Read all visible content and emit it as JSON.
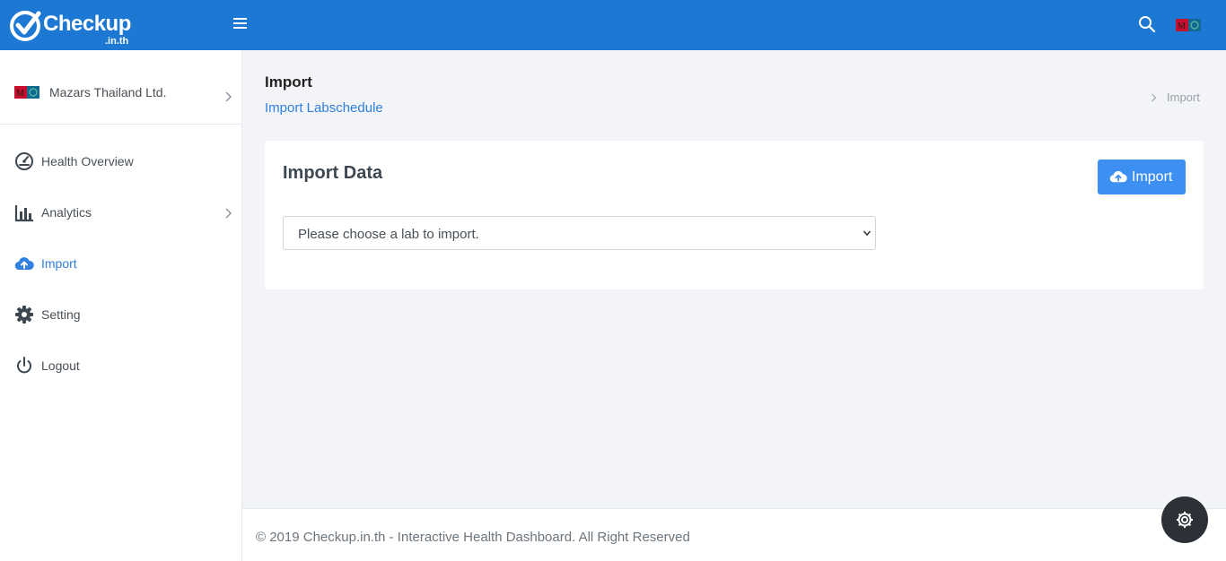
{
  "header": {
    "brand": "Checkup",
    "brand_sub": ".in.th"
  },
  "sidebar": {
    "company": "Mazars Thailand Ltd.",
    "items": [
      {
        "label": "Health Overview",
        "icon": "dashboard-gauge-icon"
      },
      {
        "label": "Analytics",
        "icon": "bar-chart-icon"
      },
      {
        "label": "Import",
        "icon": "cloud-upload-icon",
        "active": true
      },
      {
        "label": "Setting",
        "icon": "gear-icon"
      },
      {
        "label": "Logout",
        "icon": "power-icon"
      }
    ]
  },
  "page": {
    "title": "Import",
    "subtitle": "Import Labschedule",
    "breadcrumb": "Import"
  },
  "card": {
    "title": "Import Data",
    "import_button": "Import",
    "select_placeholder": "Please choose a lab to import."
  },
  "footer": {
    "text": "© 2019 Checkup.in.th - Interactive Health Dashboard. All Right Reserved"
  },
  "colors": {
    "topbar": "#1d78d4",
    "accent": "#2f80e0",
    "button": "#3d90f2"
  }
}
